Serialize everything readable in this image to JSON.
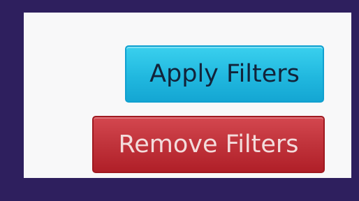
{
  "filters": {
    "apply_label": "Apply Filters",
    "remove_label": "Remove Filters"
  },
  "colors": {
    "background": "#2e1f5e",
    "panel": "#f8f8f9",
    "apply_button": "#21b8df",
    "remove_button": "#c0333b"
  }
}
